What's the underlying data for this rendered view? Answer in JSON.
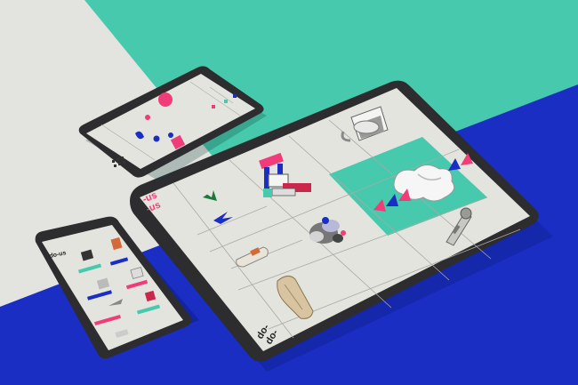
{
  "colors": {
    "background_light": "#e3e3df",
    "accent_teal": "#47c9ad",
    "accent_blue": "#1a2ec4",
    "accent_pink": "#f03c78",
    "screen_bg": "#e4e4df",
    "device_frame": "#2d2d30"
  },
  "brand": {
    "logo_top": "do-",
    "logo_bottom": "do-",
    "mark_top": "-us",
    "mark_bottom": "-us",
    "phone_logo": "do-us"
  },
  "icons": {
    "cup": "cup-icon",
    "hand": "hand-sculpture-icon",
    "figure": "figure-sculpture-icon",
    "cloud": "cloud-shape-icon",
    "tool": "tool-object-icon",
    "bird": "bird-icon",
    "gravel": "gravel-cluster-icon",
    "stone": "stone-column-icon",
    "triangles": "triangle-row-icon"
  }
}
